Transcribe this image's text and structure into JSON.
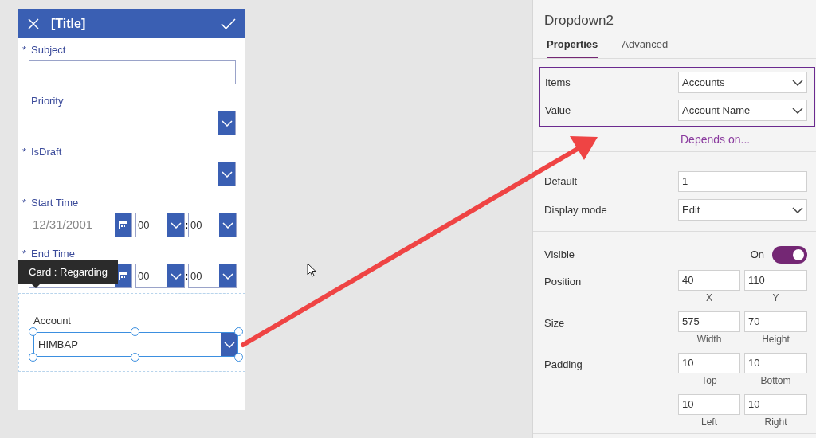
{
  "form": {
    "title": "[Title]",
    "fields": [
      {
        "kind": "text",
        "label": "Subject",
        "required_mark": "*"
      },
      {
        "kind": "dropdown",
        "label": "Priority"
      },
      {
        "kind": "dropdown",
        "label": "IsDraft",
        "required_mark": "*"
      },
      {
        "kind": "datetime",
        "label": "Start Time",
        "required_mark": "*",
        "date": "12/31/2001",
        "hour": "00",
        "separator": ":",
        "minute": "00"
      },
      {
        "kind": "datetime",
        "label": "End Time",
        "required_mark": "*",
        "hour": "00",
        "separator": ":",
        "minute": "00"
      }
    ],
    "tooltip": "Card : Regarding",
    "card": {
      "label": "Account",
      "value": "HIMBAP",
      "selected": true
    }
  },
  "panel": {
    "title": "Dropdown2",
    "tabs": [
      {
        "label": "Properties",
        "selected": true
      },
      {
        "label": "Advanced",
        "selected": false
      }
    ],
    "data_rows": [
      {
        "label": "Items",
        "value": "Accounts"
      },
      {
        "label": "Value",
        "value": "Account Name"
      }
    ],
    "link": "Depends on...",
    "default": {
      "label": "Default",
      "value": "1"
    },
    "display_mode": {
      "label": "Display mode",
      "value": "Edit"
    },
    "visible": {
      "label": "Visible",
      "state_text": "On",
      "on": true
    },
    "pairs": [
      {
        "label": "Position",
        "items": [
          {
            "value": "40",
            "caption": "X"
          },
          {
            "value": "110",
            "caption": "Y"
          }
        ]
      },
      {
        "label": "Size",
        "items": [
          {
            "value": "575",
            "caption": "Width"
          },
          {
            "value": "70",
            "caption": "Height"
          }
        ]
      },
      {
        "label": "Padding",
        "items": [
          {
            "value": "10",
            "caption": "Top"
          },
          {
            "value": "10",
            "caption": "Bottom"
          }
        ]
      },
      {
        "items": [
          {
            "value": "10",
            "caption": "Left"
          },
          {
            "value": "10",
            "caption": "Right"
          }
        ]
      }
    ]
  }
}
